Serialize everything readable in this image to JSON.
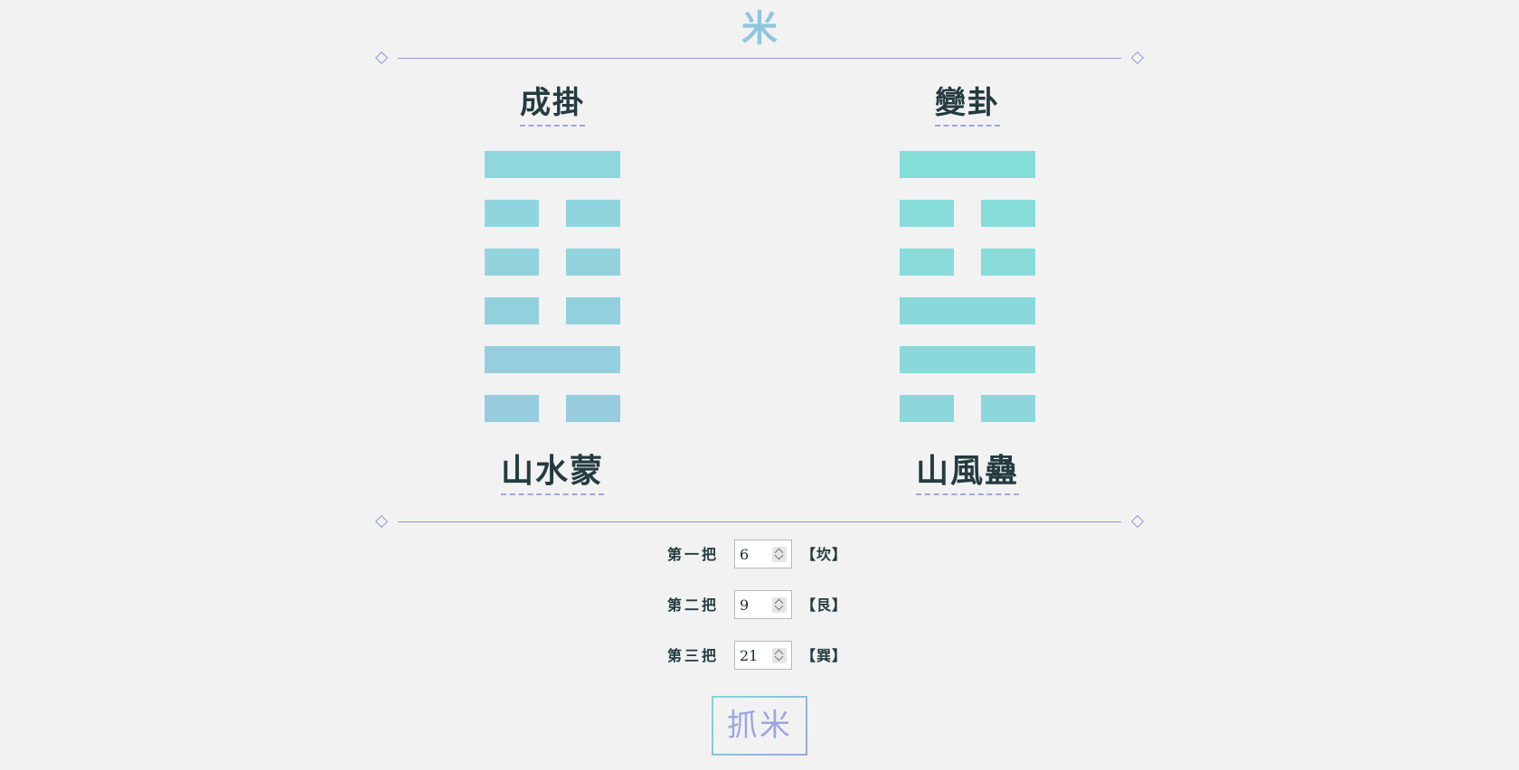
{
  "logo": {
    "text": "米"
  },
  "colors": {
    "accent": "#8e9bdc",
    "left_lines_top": "#8ed7dc",
    "left_lines_bottom": "#97ccdf",
    "right_lines_top": "#84ded8",
    "right_lines_bottom": "#8dd6db",
    "button_text": "#9aa6e2"
  },
  "left_panel": {
    "heading": "成掛",
    "name": "山水蒙",
    "lines_top_to_bottom": [
      "yang",
      "yin",
      "yin",
      "yin",
      "yang",
      "yin"
    ]
  },
  "right_panel": {
    "heading": "變卦",
    "name": "山風蠱",
    "lines_top_to_bottom": [
      "yang",
      "yin",
      "yin",
      "yang",
      "yang",
      "yin"
    ]
  },
  "inputs": [
    {
      "label": "第一把",
      "value": "6",
      "result": "【坎】"
    },
    {
      "label": "第二把",
      "value": "9",
      "result": "【艮】"
    },
    {
      "label": "第三把",
      "value": "21",
      "result": "【巽】"
    }
  ],
  "button": {
    "label": "抓米"
  }
}
